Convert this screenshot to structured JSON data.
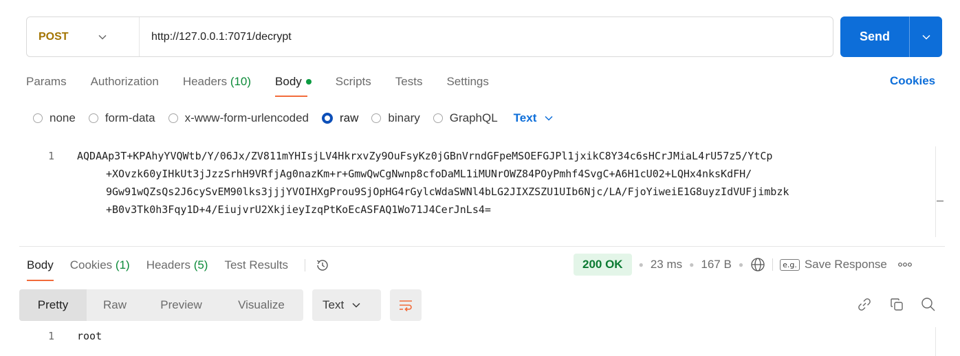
{
  "request": {
    "method": "POST",
    "url": "http://127.0.0.1:7071/decrypt",
    "send_label": "Send"
  },
  "request_tabs": {
    "params": "Params",
    "authorization": "Authorization",
    "headers": "Headers",
    "headers_count": "(10)",
    "body": "Body",
    "scripts": "Scripts",
    "tests": "Tests",
    "settings": "Settings"
  },
  "cookies_link": "Cookies",
  "body_types": {
    "none": "none",
    "form_data": "form-data",
    "urlencoded": "x-www-form-urlencoded",
    "raw": "raw",
    "binary": "binary",
    "graphql": "GraphQL",
    "selected": "raw",
    "format": "Text"
  },
  "request_body": {
    "line_number": "1",
    "lines": [
      "AQDAAp3T+KPAhyYVQWtb/Y/06Jx/ZV811mYHIsjLV4HkrxvZy9OuFsyKz0jGBnVrndGFpeMSOEFGJPl1jxikC8Y34c6sHCrJMiaL4rU57z5/YtCp",
      "+XOvzk60yIHkUt3jJzzSrhH9VRfjAg0nazKm+r+GmwQwCgNwnp8cfoDaML1iMUNrOWZ84POyPmhf4SvgC+A6H1cU02+LQHx4nksKdFH/",
      "9Gw91wQZsQs2J6cySvEM90lks3jjjYVOIHXgProu9SjOpHG4rGylcWdaSWNl4bLG2JIXZSZU1UIb6Njc/LA/FjoYiweiE1G8uyzIdVUFjimbzk",
      "+B0v3Tk0h3Fqy1D+4/EiujvrU2XkjieyIzqPtKoEcASFAQ1Wo71J4CerJnLs4="
    ]
  },
  "response_tabs": {
    "body": "Body",
    "cookies": "Cookies",
    "cookies_count": "(1)",
    "headers": "Headers",
    "headers_count": "(5)",
    "test_results": "Test Results"
  },
  "response_meta": {
    "status": "200 OK",
    "time": "23 ms",
    "size": "167 B",
    "eg_badge": "e.g.",
    "save_response": "Save Response"
  },
  "response_views": {
    "pretty": "Pretty",
    "raw": "Raw",
    "preview": "Preview",
    "visualize": "Visualize",
    "format": "Text"
  },
  "response_body": {
    "line_number": "1",
    "text": "root"
  },
  "colors": {
    "method": "#a37400",
    "send": "#0d6ed9",
    "accent_underline": "#f26b3a",
    "status_bg": "#e3f5e8",
    "status_text": "#0b7a32"
  }
}
